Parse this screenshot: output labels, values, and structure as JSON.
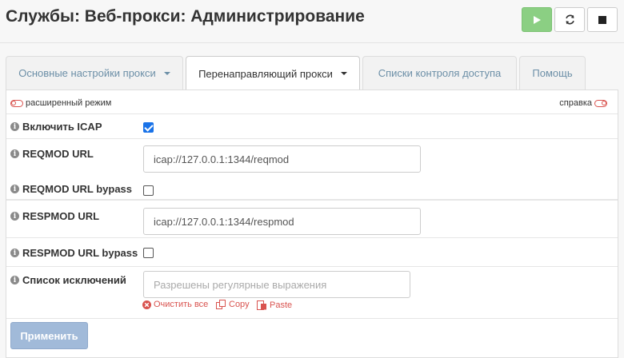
{
  "header": {
    "title": "Службы: Веб-прокси: Администрирование"
  },
  "tabs": [
    {
      "label": "Основные настройки прокси"
    },
    {
      "label": "Перенаправляющий прокси"
    },
    {
      "label": "Списки контроля доступа"
    },
    {
      "label": "Помощь"
    }
  ],
  "toolbar": {
    "advanced_label": "расширенный режим",
    "help_label": "справка"
  },
  "form": {
    "enable_icap": {
      "label": "Включить ICAP",
      "checked": true
    },
    "reqmod_url": {
      "label": "REQMOD URL",
      "value": "icap://127.0.0.1:1344/reqmod"
    },
    "reqmod_bypass": {
      "label": "REQMOD URL bypass",
      "checked": false
    },
    "respmod_url": {
      "label": "RESPMOD URL",
      "value": "icap://127.0.0.1:1344/respmod"
    },
    "respmod_bypass": {
      "label": "RESPMOD URL bypass",
      "checked": false
    },
    "exceptions": {
      "label": "Список исключений",
      "placeholder": "Разрешены регулярные выражения"
    }
  },
  "actions": {
    "clear": "Очистить все",
    "copy": "Copy",
    "paste": "Paste"
  },
  "apply_label": "Применить",
  "colors": {
    "accent": "#1a73e8",
    "play": "#8bcf83",
    "apply": "#a1bad9",
    "danger": "#d9534f"
  }
}
